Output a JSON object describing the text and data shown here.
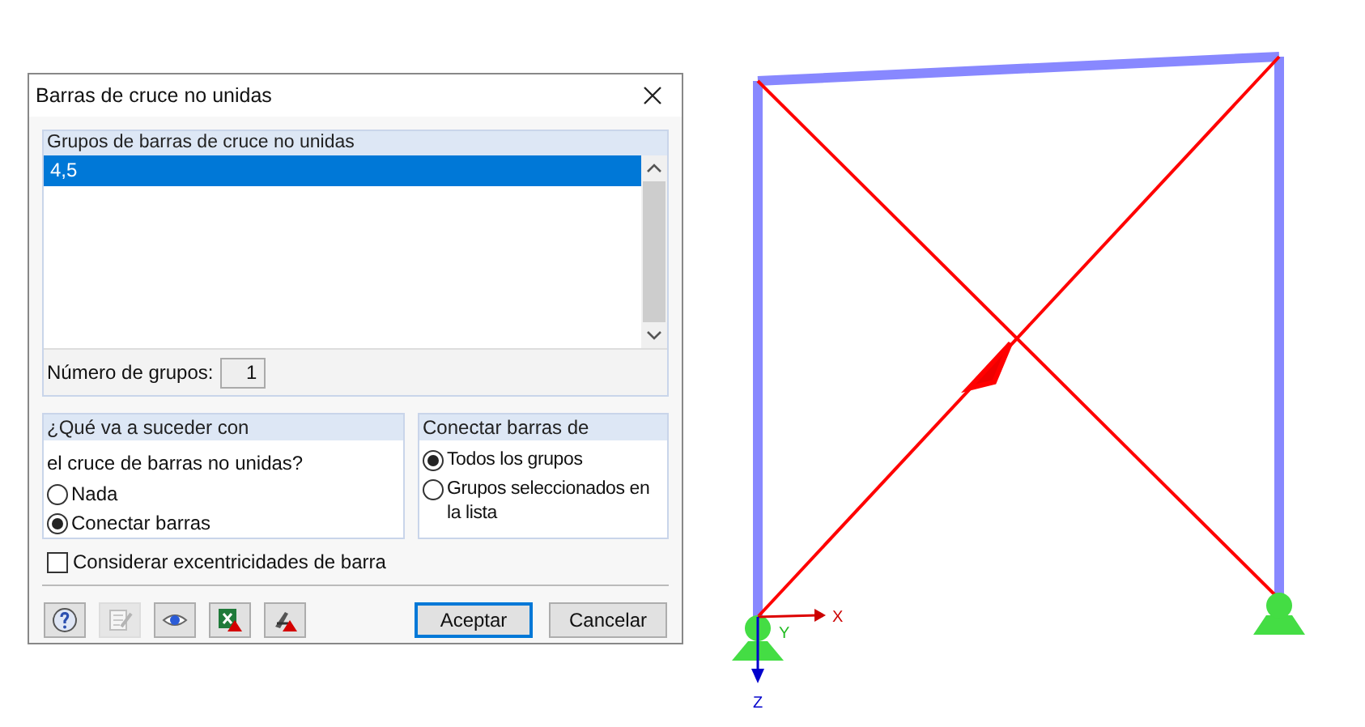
{
  "window": {
    "title": "Barras de cruce no unidas"
  },
  "groups_panel": {
    "title": "Grupos de barras de cruce no unidas",
    "items": [
      {
        "label": "4,5",
        "selected": true
      }
    ],
    "count_label": "Número de grupos:",
    "count_value": "1"
  },
  "action_panel": {
    "title": "¿Qué va a suceder con",
    "prompt": "el cruce de barras no unidas?",
    "options": [
      {
        "label": "Nada",
        "selected": false
      },
      {
        "label": "Conectar barras",
        "selected": true
      }
    ]
  },
  "connect_panel": {
    "title": "Conectar barras de",
    "options": [
      {
        "label": "Todos los grupos",
        "selected": true
      },
      {
        "label": "Grupos seleccionados en la lista",
        "selected": false
      }
    ]
  },
  "eccentricity": {
    "label": "Considerar excentricidades de barra",
    "checked": false
  },
  "icon_buttons": [
    {
      "kind": "help",
      "disabled": false
    },
    {
      "kind": "edit",
      "disabled": true
    },
    {
      "kind": "view",
      "disabled": false
    },
    {
      "kind": "excel",
      "disabled": false
    },
    {
      "kind": "tool",
      "disabled": false
    }
  ],
  "buttons": [
    {
      "label": "Aceptar",
      "default": true
    },
    {
      "label": "Cancelar",
      "default": false
    }
  ],
  "model": {
    "axes": [
      {
        "label": "X"
      },
      {
        "label": "Y"
      },
      {
        "label": "Z"
      }
    ]
  }
}
